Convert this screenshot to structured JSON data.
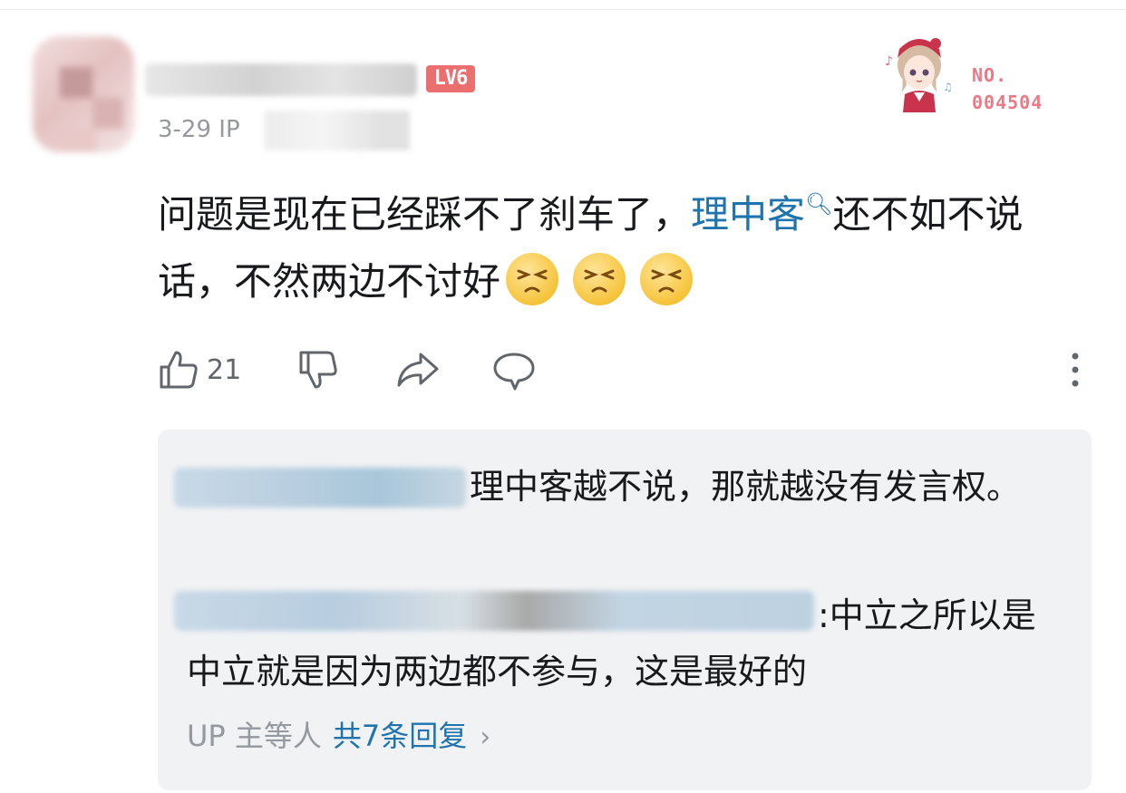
{
  "comment": {
    "level_badge": "LV6",
    "date_ip": "3-29  IP",
    "fan_badge": {
      "label": "NO.",
      "number": "004504"
    },
    "content_before": "问题是现在已经踩不了刹车了，",
    "keyword_link": "理中客",
    "content_after": "还不如不说话，不然两边不讨好",
    "emoji_count": 3,
    "like_count": "21"
  },
  "replies": {
    "items": [
      {
        "text": "理中客越不说，那就越没有发言权。"
      },
      {
        "text": ":中立之所以是中立就是因为两边都不参与，这是最好的"
      }
    ],
    "more_by": "UP 主等人",
    "total_label": "共7条回复",
    "chevron": "›"
  },
  "colors": {
    "link": "#1f74ad",
    "meta": "#9499a0",
    "reply_bg": "#f1f2f4",
    "level_badge": "#ec6f6f",
    "fan_badge_text": "#ec7a86"
  },
  "icons": [
    "like-icon",
    "dislike-icon",
    "share-icon",
    "reply-icon",
    "more-icon",
    "search-icon",
    "emoji-icon"
  ]
}
